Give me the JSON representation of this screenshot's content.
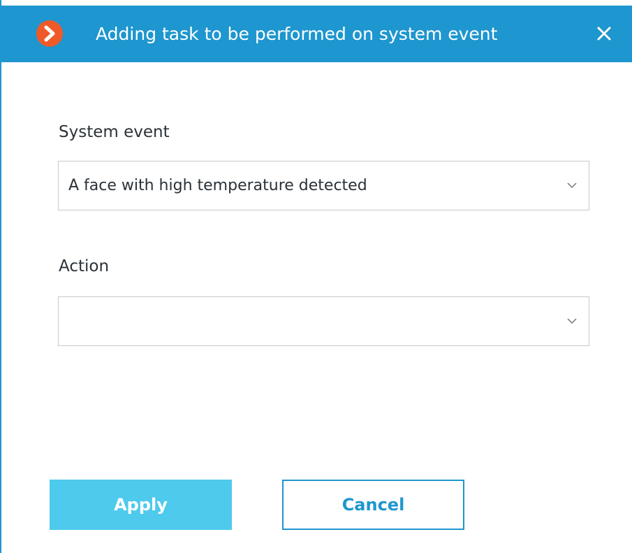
{
  "dialog": {
    "title": "Adding task to be performed on system event",
    "icons": {
      "app": "chevron-right-circle-icon",
      "close": "close-icon"
    }
  },
  "form": {
    "system_event": {
      "label": "System event",
      "value": "A face with high temperature detected"
    },
    "action": {
      "label": "Action",
      "value": ""
    }
  },
  "buttons": {
    "apply_label": "Apply",
    "cancel_label": "Cancel"
  },
  "colors": {
    "accent": "#1e96cf",
    "apply_button": "#4ecaed",
    "app_icon": "#f05a28"
  }
}
